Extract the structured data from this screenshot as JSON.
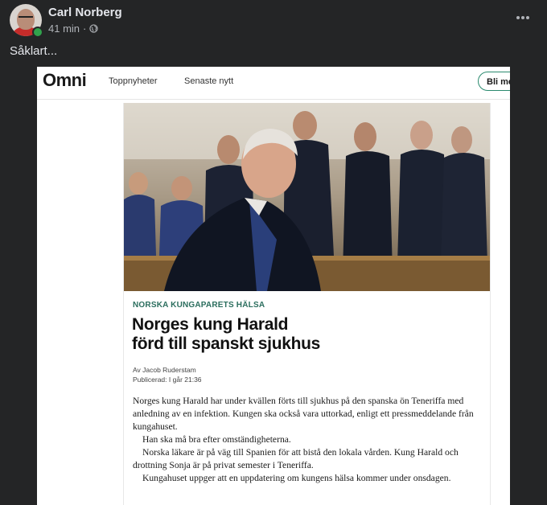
{
  "post": {
    "author": "Carl Norberg",
    "time": "41 min",
    "separator": "·",
    "text": "Såklart...",
    "more_icon": "more-horizontal-icon",
    "privacy_icon": "globe-icon"
  },
  "omni": {
    "logo": "Omni",
    "nav": [
      "Toppnyheter",
      "Senaste nytt"
    ],
    "cta_label": "Bli me"
  },
  "article": {
    "kicker": "NORSKA KUNGAPARETS HÄLSA",
    "headline_line1": "Norges kung Harald",
    "headline_line2": "förd till spanskt sjukhus",
    "byline": "Av Jacob Ruderstam",
    "published": "Publicerad: I går 21:36",
    "paragraphs": [
      "Norges kung Harald har under kvällen förts till sjukhus på den spanska ön Teneriffa med anledning av en infektion. Kungen ska också vara uttorkad, enligt ett pressmeddelande från kungahuset.",
      "Han ska må bra efter omständigheterna.",
      "Norska läkare är på väg till Spanien för att bistå den lokala vården. Kung Harald och drottning Sonja är på privat semester i Teneriffa.",
      "Kungahuset uppger att en uppdatering om kungens hälsa kommer under onsdagen."
    ]
  },
  "colors": {
    "background": "#242526",
    "text_primary": "#e4e6eb",
    "text_secondary": "#b0b3b8",
    "kicker": "#2b6e5e",
    "online": "#31a24c"
  }
}
